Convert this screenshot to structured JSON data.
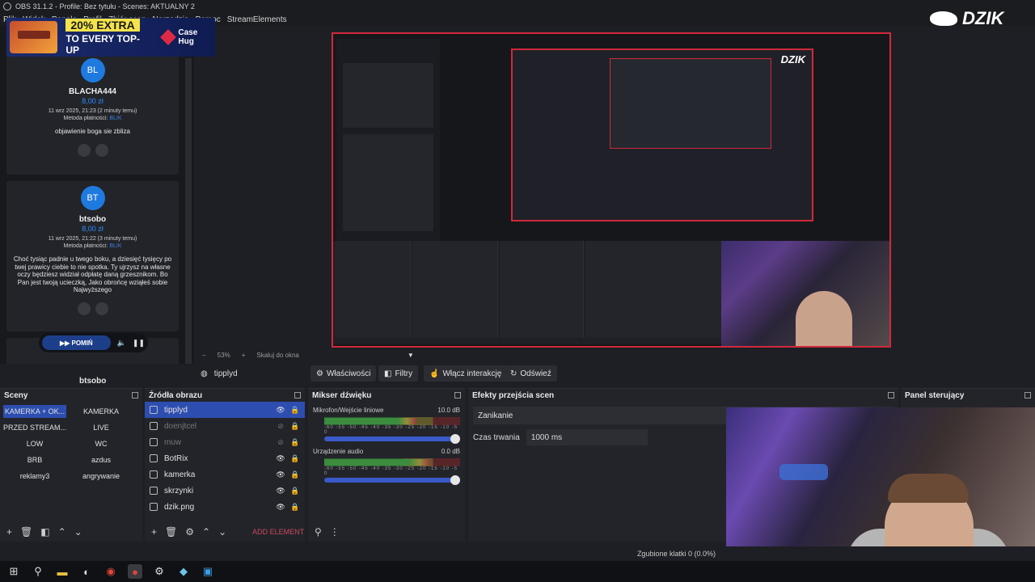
{
  "window": {
    "title": "OBS 31.1.2 - Profile: Bez tytułu - Scenes: AKTUALNY 2"
  },
  "menu": [
    "Plik",
    "Widok",
    "Panele",
    "Profil",
    "Zbiór scen",
    "Narzędzia",
    "Pomoc",
    "StreamElements"
  ],
  "ad": {
    "percent": "20% EXTRA",
    "sub": "TO EVERY TOP-UP",
    "brand": "Case Hug"
  },
  "logo_text": "DZIK",
  "donations": [
    {
      "initials": "BL",
      "name": "BLACHA444",
      "amount": "8,00 zł",
      "date": "11 wrz 2025, 21:23 (2 minuty temu)",
      "method_label": "Metoda płatności:",
      "method": "BLIK",
      "message": "objawienie boga sie zbliza"
    },
    {
      "initials": "BT",
      "name": "btsobo",
      "amount": "8,00 zł",
      "date": "11 wrz 2025, 21:22 (3 minuty temu)",
      "method_label": "Metoda płatności:",
      "method": "BLIK",
      "message": "Choć tysiąc padnie u twego boku, a dziesięć tysięcy po twej prawicy ciebie to nie spotka. Ty ujrzysz na własne oczy będziesz widział odpłatę daną grzesznikom. Bo Pan jest twoją ucieczką, Jako obrońcę wziąłeś sobie Najwyższego"
    }
  ],
  "donation_peek": "btsobo",
  "skip_label": "POMIŃ",
  "zoom": {
    "percent": "53%",
    "mode": "Skaluj do okna"
  },
  "source_toolbar": {
    "selected": "tipplyd",
    "properties": "Właściwości",
    "filters": "Filtry",
    "interact": "Włącz interakcję",
    "refresh": "Odświeź"
  },
  "docks": {
    "scenes_title": "Sceny",
    "sources_title": "Źródła obrazu",
    "mixer_title": "Mikser dźwięku",
    "transitions_title": "Efekty przejścia scen",
    "controls_title": "Panel sterujący"
  },
  "scenes": [
    [
      "KAMERKA + OK...",
      "KAMERKA"
    ],
    [
      "PRZED STREAM...",
      "LIVE"
    ],
    [
      "LOW",
      "WC"
    ],
    [
      "BRB",
      "azdus"
    ],
    [
      "reklamy3",
      "angrywanie"
    ]
  ],
  "sources": [
    {
      "name": "tipplyd",
      "state": "active"
    },
    {
      "name": "doenjtcel",
      "state": "dim"
    },
    {
      "name": "muw",
      "state": "dim"
    },
    {
      "name": "BotRix",
      "state": "visible"
    },
    {
      "name": "kamerka",
      "state": "visible"
    },
    {
      "name": "skrzynki",
      "state": "visible"
    },
    {
      "name": "dzik.png",
      "state": "visible"
    }
  ],
  "add_element": "ADD ELEMENT",
  "mixer": [
    {
      "name": "Mikrofon/Wejście liniowe",
      "db": "10.0 dB",
      "level": 0.68
    },
    {
      "name": "Urządzenie audio",
      "db": "0.0 dB",
      "level": 0.78
    }
  ],
  "mixer_ticks": "-60 -55 -50 -45 -40 -35 -30 -25 -20 -15 -10 -5 0",
  "transition": {
    "selected": "Zanikanie",
    "duration_label": "Czas trwania",
    "duration": "1000 ms"
  },
  "status": {
    "dropped": "Zgubione klatki 0 (0.0%)"
  },
  "colors": {
    "accent": "#2d4eb0",
    "preview_border": "#d0293b",
    "panel": "#23242a"
  }
}
